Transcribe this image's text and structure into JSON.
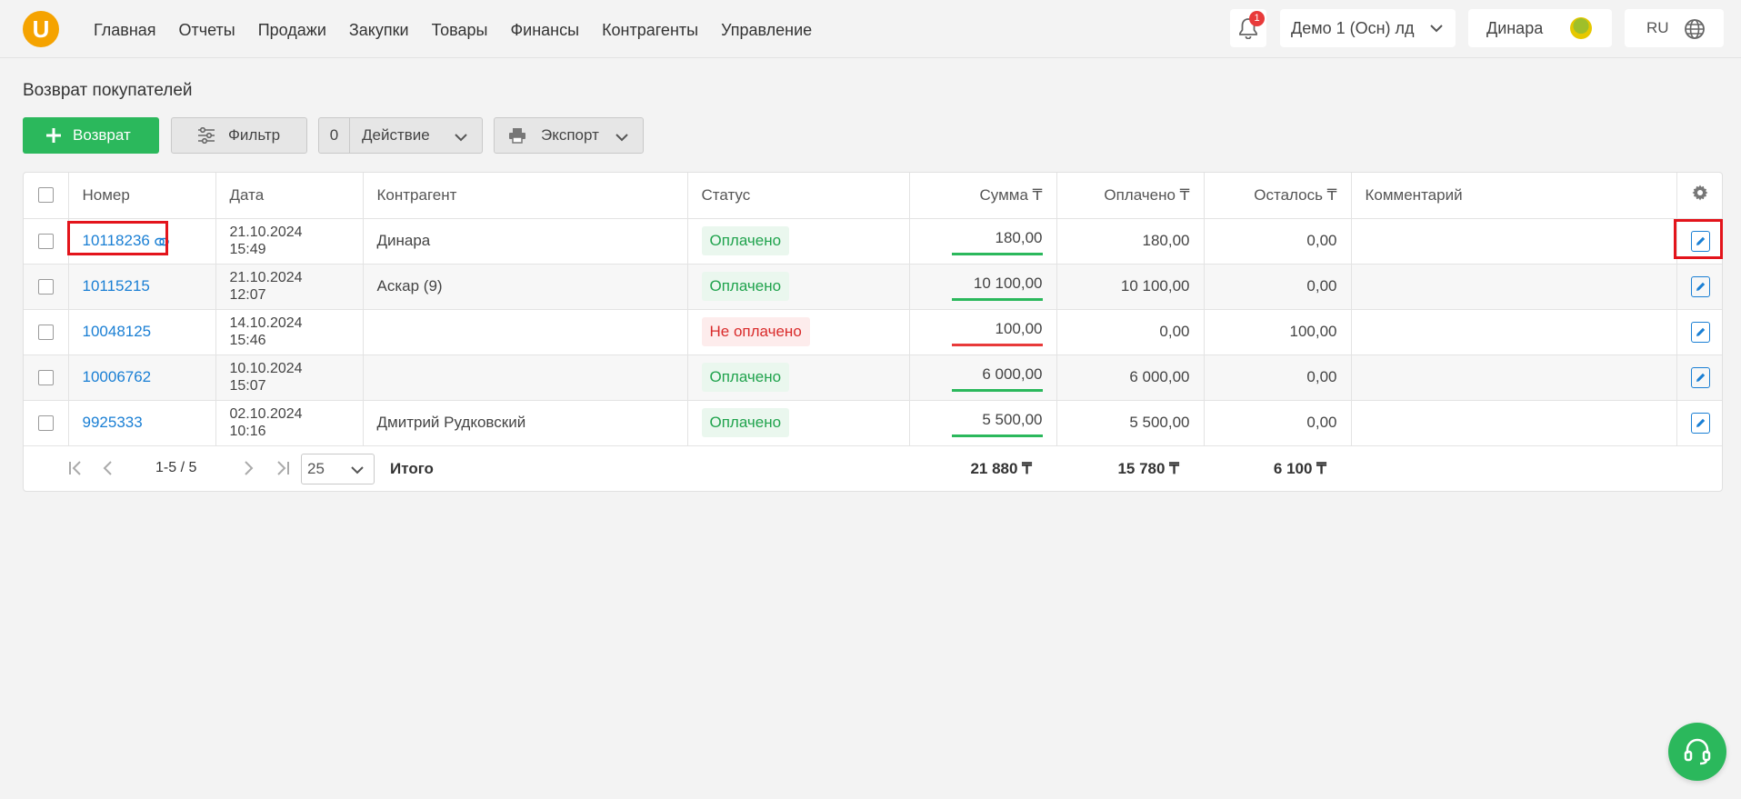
{
  "header": {
    "logo": "U",
    "nav": [
      "Главная",
      "Отчеты",
      "Продажи",
      "Закупки",
      "Товары",
      "Финансы",
      "Контрагенты",
      "Управление"
    ],
    "notifications_count": "1",
    "organization": "Демо 1 (Осн) лд",
    "user": "Динара",
    "language": "RU"
  },
  "page": {
    "title": "Возврат покупателей"
  },
  "toolbar": {
    "add_label": "Возврат",
    "filter_label": "Фильтр",
    "action_count": "0",
    "action_label": "Действие",
    "export_label": "Экспорт"
  },
  "table": {
    "columns": [
      "Номер",
      "Дата",
      "Контрагент",
      "Статус",
      "Сумма ₸",
      "Оплачено ₸",
      "Осталось ₸",
      "Комментарий"
    ],
    "rows": [
      {
        "number": "10118236",
        "date": "21.10.2024",
        "time": "15:49",
        "counterparty": "Динара",
        "status": "Оплачено",
        "status_type": "paid",
        "sum": "180,00",
        "paid": "180,00",
        "left": "0,00",
        "comment": "",
        "bar_color": "#2bb85c"
      },
      {
        "number": "10115215",
        "date": "21.10.2024",
        "time": "12:07",
        "counterparty": "Аскар (9)",
        "status": "Оплачено",
        "status_type": "paid",
        "sum": "10 100,00",
        "paid": "10 100,00",
        "left": "0,00",
        "comment": "",
        "bar_color": "#2bb85c"
      },
      {
        "number": "10048125",
        "date": "14.10.2024",
        "time": "15:46",
        "counterparty": "",
        "status": "Не оплачено",
        "status_type": "unpaid",
        "sum": "100,00",
        "paid": "0,00",
        "left": "100,00",
        "comment": "",
        "bar_color": "#e83a3a"
      },
      {
        "number": "10006762",
        "date": "10.10.2024",
        "time": "15:07",
        "counterparty": "",
        "status": "Оплачено",
        "status_type": "paid",
        "sum": "6 000,00",
        "paid": "6 000,00",
        "left": "0,00",
        "comment": "",
        "bar_color": "#2bb85c"
      },
      {
        "number": "9925333",
        "date": "02.10.2024",
        "time": "10:16",
        "counterparty": "Дмитрий Рудковский",
        "status": "Оплачено",
        "status_type": "paid",
        "sum": "5 500,00",
        "paid": "5 500,00",
        "left": "0,00",
        "comment": "",
        "bar_color": "#2bb85c"
      }
    ]
  },
  "pagination": {
    "range": "1-5 / 5",
    "per_page": "25"
  },
  "totals": {
    "label": "Итого",
    "sum": "21 880 ₸",
    "paid": "15 780 ₸",
    "left": "6 100 ₸"
  },
  "colors": {
    "accent_green": "#2bb85c",
    "link_blue": "#1a7fd4",
    "unpaid_red": "#d92b2b",
    "highlight": "#e3141b"
  }
}
